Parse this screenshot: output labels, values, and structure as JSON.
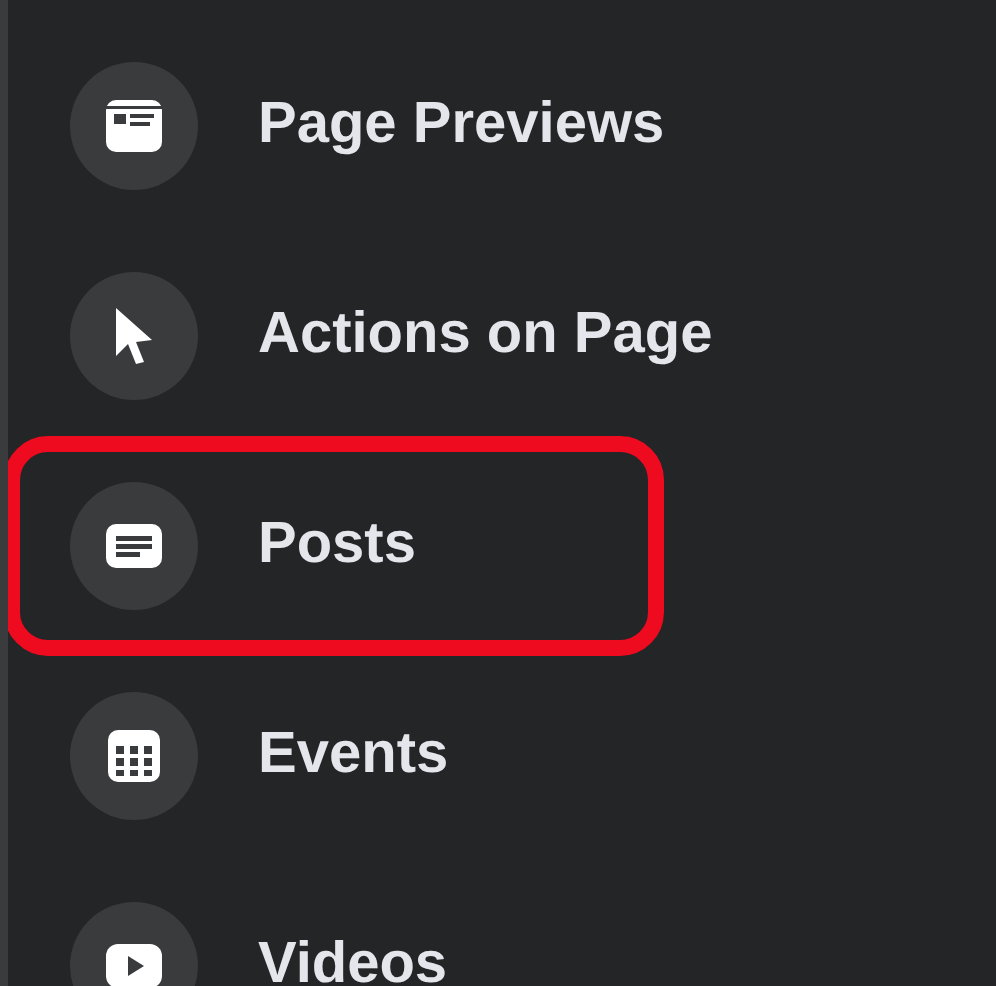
{
  "menu_items": [
    {
      "label": "Page Previews",
      "highlighted": false
    },
    {
      "label": "Actions on Page",
      "highlighted": false
    },
    {
      "label": "Posts",
      "highlighted": true
    },
    {
      "label": "Events",
      "highlighted": false
    },
    {
      "label": "Videos",
      "highlighted": false
    }
  ]
}
